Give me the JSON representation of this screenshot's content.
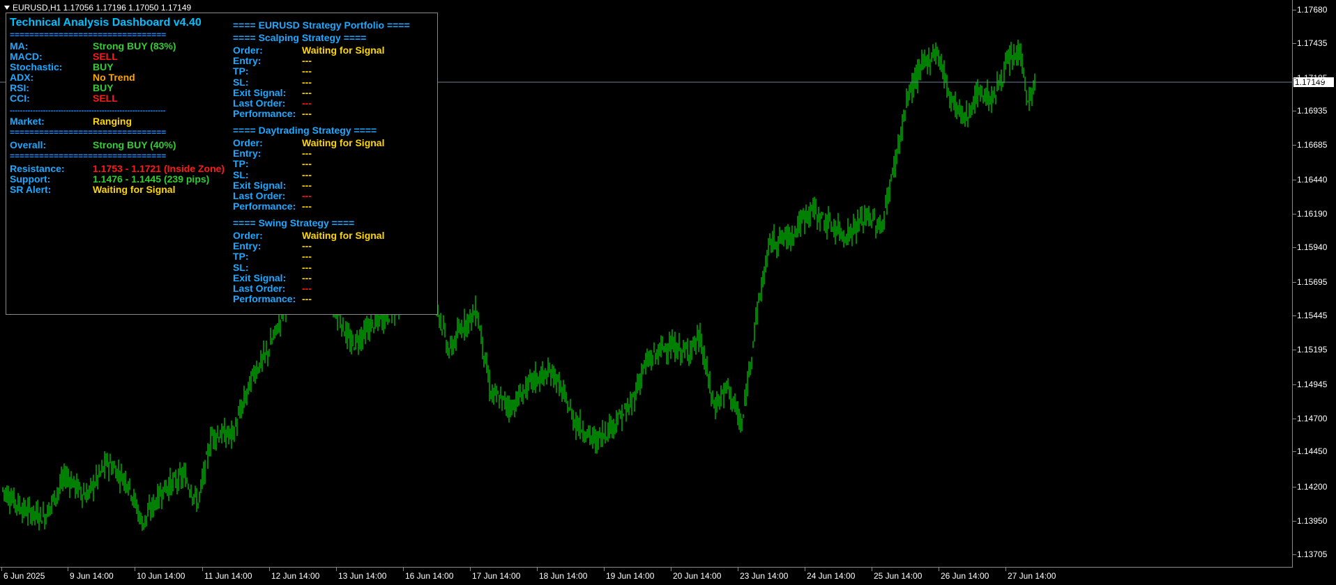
{
  "window": {
    "title": "EURUSD,H1  1.17056 1.17196 1.17050 1.17149"
  },
  "colors": {
    "background": "#000000",
    "candle": "#00ff00",
    "bid_line": "#6a7f92",
    "label": "#1ea8ff",
    "buy": "#32cd32",
    "sell": "#ff1a1a",
    "neutral": "#ffd700",
    "trend_none": "#ffa500"
  },
  "price_axis": {
    "labels": [
      "1.17680",
      "1.17435",
      "1.17185",
      "1.16935",
      "1.16685",
      "1.16440",
      "1.16190",
      "1.15940",
      "1.15695",
      "1.15445",
      "1.15195",
      "1.14945",
      "1.14700",
      "1.14450",
      "1.14200",
      "1.13950",
      "1.13705"
    ],
    "current_price": "1.17149"
  },
  "time_axis": {
    "labels": [
      "6 Jun 2025",
      "9 Jun 14:00",
      "10 Jun 14:00",
      "11 Jun 14:00",
      "12 Jun 14:00",
      "13 Jun 14:00",
      "16 Jun 14:00",
      "17 Jun 14:00",
      "18 Jun 14:00",
      "19 Jun 14:00",
      "20 Jun 14:00",
      "23 Jun 14:00",
      "24 Jun 14:00",
      "25 Jun 14:00",
      "26 Jun 14:00",
      "27 Jun 14:00"
    ]
  },
  "chart_data": {
    "type": "candlestick",
    "symbol": "EURUSD",
    "timeframe": "H1",
    "ylim": [
      1.1368,
      1.1772
    ],
    "current_price": 1.17149,
    "close_path": [
      [
        0,
        1.142
      ],
      [
        30,
        1.1405
      ],
      [
        60,
        1.14
      ],
      [
        90,
        1.143
      ],
      [
        120,
        1.1415
      ],
      [
        150,
        1.144
      ],
      [
        180,
        1.1425
      ],
      [
        200,
        1.1395
      ],
      [
        230,
        1.142
      ],
      [
        260,
        1.143
      ],
      [
        280,
        1.141
      ],
      [
        300,
        1.146
      ],
      [
        330,
        1.146
      ],
      [
        360,
        1.1505
      ],
      [
        380,
        1.152
      ],
      [
        410,
        1.156
      ],
      [
        440,
        1.161
      ],
      [
        470,
        1.156
      ],
      [
        500,
        1.1525
      ],
      [
        530,
        1.154
      ],
      [
        560,
        1.155
      ],
      [
        590,
        1.157
      ],
      [
        620,
        1.156
      ],
      [
        640,
        1.152
      ],
      [
        660,
        1.154
      ],
      [
        680,
        1.155
      ],
      [
        700,
        1.149
      ],
      [
        730,
        1.148
      ],
      [
        760,
        1.15
      ],
      [
        790,
        1.1505
      ],
      [
        820,
        1.147
      ],
      [
        850,
        1.1455
      ],
      [
        880,
        1.147
      ],
      [
        900,
        1.148
      ],
      [
        920,
        1.151
      ],
      [
        950,
        1.1525
      ],
      [
        980,
        1.152
      ],
      [
        1000,
        1.153
      ],
      [
        1020,
        1.148
      ],
      [
        1040,
        1.1495
      ],
      [
        1060,
        1.1465
      ],
      [
        1080,
        1.1545
      ],
      [
        1100,
        1.16
      ],
      [
        1130,
        1.1605
      ],
      [
        1160,
        1.1625
      ],
      [
        1180,
        1.1615
      ],
      [
        1210,
        1.1605
      ],
      [
        1240,
        1.162
      ],
      [
        1260,
        1.161
      ],
      [
        1280,
        1.166
      ],
      [
        1300,
        1.171
      ],
      [
        1320,
        1.173
      ],
      [
        1340,
        1.174
      ],
      [
        1360,
        1.1705
      ],
      [
        1380,
        1.169
      ],
      [
        1400,
        1.171
      ],
      [
        1420,
        1.1705
      ],
      [
        1440,
        1.173
      ],
      [
        1460,
        1.174
      ],
      [
        1470,
        1.17
      ],
      [
        1480,
        1.1715
      ]
    ]
  },
  "dashboard": {
    "title": "Technical Analysis Dashboard v4.40",
    "separator_long": "================================",
    "separator_dash": "-------------------------------------------------------------",
    "indicators": [
      {
        "label": "MA:",
        "value": "Strong BUY (83%)",
        "color": "#32cd32"
      },
      {
        "label": "MACD:",
        "value": "SELL",
        "color": "#ff1a1a"
      },
      {
        "label": "Stochastic:",
        "value": "BUY",
        "color": "#32cd32"
      },
      {
        "label": "ADX:",
        "value": "No Trend",
        "color": "#ffa500"
      },
      {
        "label": "RSI:",
        "value": "BUY",
        "color": "#32cd32"
      },
      {
        "label": "CCI:",
        "value": "SELL",
        "color": "#ff1a1a"
      }
    ],
    "market": {
      "label": "Market:",
      "value": "Ranging"
    },
    "overall": {
      "label": "Overall:",
      "value": "Strong BUY (40%)"
    },
    "resistance": {
      "label": "Resistance:",
      "value": "1.1753 - 1.1721 (Inside Zone)"
    },
    "support": {
      "label": "Support:",
      "value": "1.1476 - 1.1445 (239 pips)"
    },
    "sr_alert": {
      "label": "SR Alert:",
      "value": "Waiting for Signal"
    },
    "portfolio_title": "==== EURUSD Strategy Portfolio ====",
    "strategies": [
      {
        "title": "==== Scalping Strategy ====",
        "order": "Waiting for Signal",
        "entry": "---",
        "tp": "---",
        "sl": "---",
        "exit_signal": "---",
        "last_order": "---",
        "performance": "---"
      },
      {
        "title": "==== Daytrading Strategy ====",
        "order": "Waiting for Signal",
        "entry": "---",
        "tp": "---",
        "sl": "---",
        "exit_signal": "---",
        "last_order": "---",
        "performance": "---"
      },
      {
        "title": "==== Swing Strategy ====",
        "order": "Waiting for Signal",
        "entry": "---",
        "tp": "---",
        "sl": "---",
        "exit_signal": "---",
        "last_order": "---",
        "performance": "---"
      }
    ],
    "field_labels": {
      "order": "Order:",
      "entry": "Entry:",
      "tp": "TP:",
      "sl": "SL:",
      "exit_signal": "Exit Signal:",
      "last_order": "Last Order:",
      "performance": "Performance:"
    }
  }
}
